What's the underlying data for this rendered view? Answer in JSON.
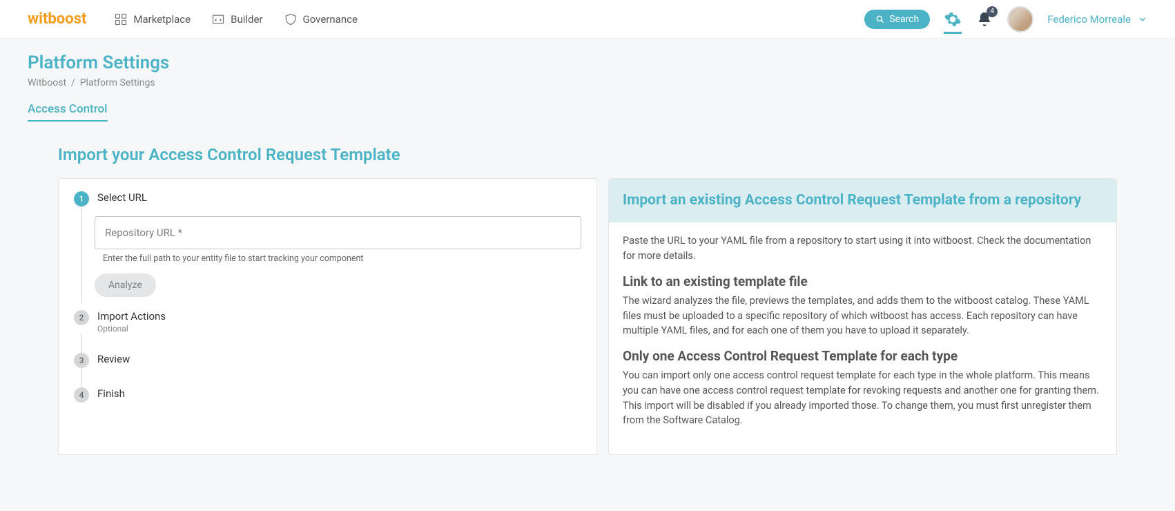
{
  "header": {
    "logo_text": "witboost",
    "nav": [
      {
        "label": "Marketplace"
      },
      {
        "label": "Builder"
      },
      {
        "label": "Governance"
      }
    ],
    "search_label": "Search",
    "notifications_count": "4",
    "user_name": "Federico Morreale"
  },
  "page": {
    "title": "Platform Settings",
    "breadcrumb_root": "Witboost",
    "breadcrumb_current": "Platform Settings",
    "tab_label": "Access Control",
    "section_title": "Import your Access Control Request Template"
  },
  "stepper": {
    "steps": [
      {
        "num": "1",
        "title": "Select URL"
      },
      {
        "num": "2",
        "title": "Import Actions",
        "sub": "Optional"
      },
      {
        "num": "3",
        "title": "Review"
      },
      {
        "num": "4",
        "title": "Finish"
      }
    ],
    "input_label": "Repository URL *",
    "helper_text": "Enter the full path to your entity file to start tracking your component",
    "analyze_label": "Analyze"
  },
  "info": {
    "heading": "Import an existing Access Control Request Template from a repository",
    "p1": "Paste the URL to your YAML file from a repository to start using it into witboost. Check the documentation for more details.",
    "h2": "Link to an existing template file",
    "p2": "The wizard analyzes the file, previews the templates, and adds them to the witboost catalog. These YAML files must be uploaded to a specific repository of which witboost has access. Each repository can have multiple YAML files, and for each one of them you have to upload it separately.",
    "h3": "Only one Access Control Request Template for each type",
    "p3": "You can import only one access control request template for each type in the whole platform. This means you can have one access control request template for revoking requests and another one for granting them. This import will be disabled if you already imported those. To change them, you must first unregister them from the Software Catalog."
  }
}
